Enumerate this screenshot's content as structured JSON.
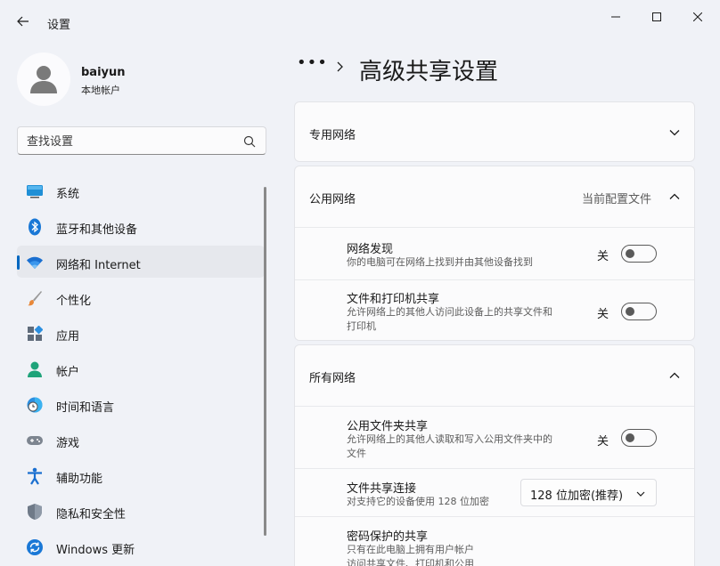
{
  "window": {
    "title": "设置",
    "controls": {
      "minimize": "minimize-icon",
      "maximize": "maximize-icon",
      "close": "close-icon"
    }
  },
  "profile": {
    "name": "baiyun",
    "account_type": "本地帐户"
  },
  "search": {
    "placeholder": "查找设置"
  },
  "sidebar": {
    "items": [
      {
        "label": "系统",
        "icon": "system-icon"
      },
      {
        "label": "蓝牙和其他设备",
        "icon": "bluetooth-icon"
      },
      {
        "label": "网络和 Internet",
        "icon": "wifi-icon",
        "active": true
      },
      {
        "label": "个性化",
        "icon": "brush-icon"
      },
      {
        "label": "应用",
        "icon": "apps-icon"
      },
      {
        "label": "帐户",
        "icon": "account-icon"
      },
      {
        "label": "时间和语言",
        "icon": "time-language-icon"
      },
      {
        "label": "游戏",
        "icon": "gamepad-icon"
      },
      {
        "label": "辅助功能",
        "icon": "accessibility-icon"
      },
      {
        "label": "隐私和安全性",
        "icon": "shield-icon"
      },
      {
        "label": "Windows 更新",
        "icon": "update-icon"
      }
    ]
  },
  "breadcrumb": {
    "ellipsis": "•••",
    "title": "高级共享设置"
  },
  "sections": {
    "private": {
      "label": "专用网络",
      "expanded": false
    },
    "public": {
      "label": "公用网络",
      "badge": "当前配置文件",
      "expanded": true,
      "settings": [
        {
          "title": "网络发现",
          "desc": "你的电脑可在网络上找到并由其他设备找到",
          "state": "关",
          "on": false
        },
        {
          "title": "文件和打印机共享",
          "desc_line1": "允许网络上的其他人访问此设备上的共享文件和",
          "desc_line2": "打印机",
          "state": "关",
          "on": false
        }
      ]
    },
    "all": {
      "label": "所有网络",
      "expanded": true,
      "settings": [
        {
          "title": "公用文件夹共享",
          "desc_line1": "允许网络上的其他人读取和写入公用文件夹中的",
          "desc_line2": "文件",
          "state": "关",
          "on": false
        },
        {
          "title": "文件共享连接",
          "desc": "对支持它的设备使用 128 位加密",
          "dropdown": "128 位加密(推荐)"
        },
        {
          "title": "密码保护的共享",
          "desc_line1": "只有在此电脑上拥有用户帐户",
          "desc_line2": "访问共享文件、打印机和公用"
        }
      ]
    }
  },
  "colors": {
    "accent": "#0067c0",
    "window_bg": "#f0f2f7",
    "card_bg": "#fbfbfc"
  }
}
